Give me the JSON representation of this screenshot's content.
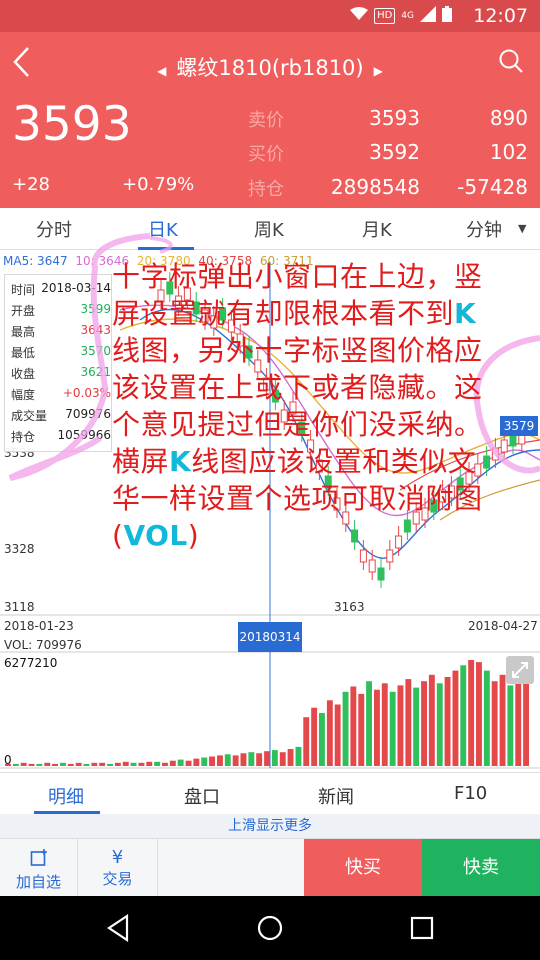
{
  "status_bar": {
    "time": "12:07",
    "network": "4G",
    "hd": "HD"
  },
  "header": {
    "title": "螺纹1810(rb1810)",
    "last_price": "3593",
    "change": "+28",
    "change_pct": "+0.79%",
    "quotes": [
      {
        "label": "卖价",
        "v1": "3593",
        "v2": "890"
      },
      {
        "label": "买价",
        "v1": "3592",
        "v2": "102"
      },
      {
        "label": "持仓",
        "v1": "2898548",
        "v2": "-57428"
      }
    ]
  },
  "tabs": [
    "分时",
    "日K",
    "周K",
    "月K",
    "分钟"
  ],
  "ma_line": [
    "MA5: 3647",
    "10: 3646",
    "20: 3780",
    "40: 3758",
    "60: 3711"
  ],
  "popup": [
    {
      "label": "时间",
      "value": "2018-03-14"
    },
    {
      "label": "开盘",
      "value": "3599"
    },
    {
      "label": "最高",
      "value": "3643"
    },
    {
      "label": "最低",
      "value": "3570"
    },
    {
      "label": "收盘",
      "value": "3621"
    },
    {
      "label": "幅度",
      "value": "+0.03%"
    },
    {
      "label": "成交量",
      "value": "709976"
    },
    {
      "label": "持仓",
      "value": "1059966"
    }
  ],
  "price_axis": {
    "y1": "3538",
    "y2": "3328",
    "y3": "3118",
    "low_marker": "3163",
    "current_tag": "3579"
  },
  "date_axis": {
    "start": "2018-01-23",
    "end": "2018-04-27",
    "cursor": "20180314"
  },
  "volume": {
    "label": "VOL: 709976",
    "max": "6277210",
    "zero": "0"
  },
  "annotation": {
    "part1": "十字标弹出小窗口在上边，竖屏设置就有却限根本看不到",
    "k1": "K",
    "part2": "线图，另外十字标竖图价格应该设置在上或下或者隐藏。这个意见提过但是你们没采纳。横屏",
    "k2": "K",
    "part3": "线图应该设置和类似文华一样设置个选项可取消附图(",
    "vol": "VOL",
    "part4": ")"
  },
  "bottom_tabs": [
    "明细",
    "盘口",
    "新闻",
    "F10"
  ],
  "hint": "上滑显示更多",
  "actions": {
    "watch": "加自选",
    "trade": "交易",
    "buy": "快买",
    "sell": "快卖"
  },
  "chart_data": {
    "type": "bar",
    "series": [
      {
        "name": "VOL",
        "values": [
          0.02,
          0.02,
          0.03,
          0.02,
          0.02,
          0.03,
          0.02,
          0.03,
          0.02,
          0.03,
          0.02,
          0.03,
          0.03,
          0.02,
          0.03,
          0.04,
          0.03,
          0.03,
          0.04,
          0.04,
          0.03,
          0.05,
          0.06,
          0.05,
          0.07,
          0.08,
          0.09,
          0.1,
          0.11,
          0.1,
          0.12,
          0.13,
          0.12,
          0.14,
          0.15,
          0.13,
          0.16,
          0.18,
          0.46,
          0.55,
          0.5,
          0.62,
          0.58,
          0.7,
          0.75,
          0.68,
          0.8,
          0.72,
          0.78,
          0.7,
          0.76,
          0.82,
          0.74,
          0.8,
          0.86,
          0.78,
          0.84,
          0.9,
          0.95,
          1.0,
          0.98,
          0.9,
          0.8,
          0.86,
          0.76,
          0.9,
          0.82
        ]
      }
    ],
    "ylim": [
      0,
      6277210
    ]
  }
}
